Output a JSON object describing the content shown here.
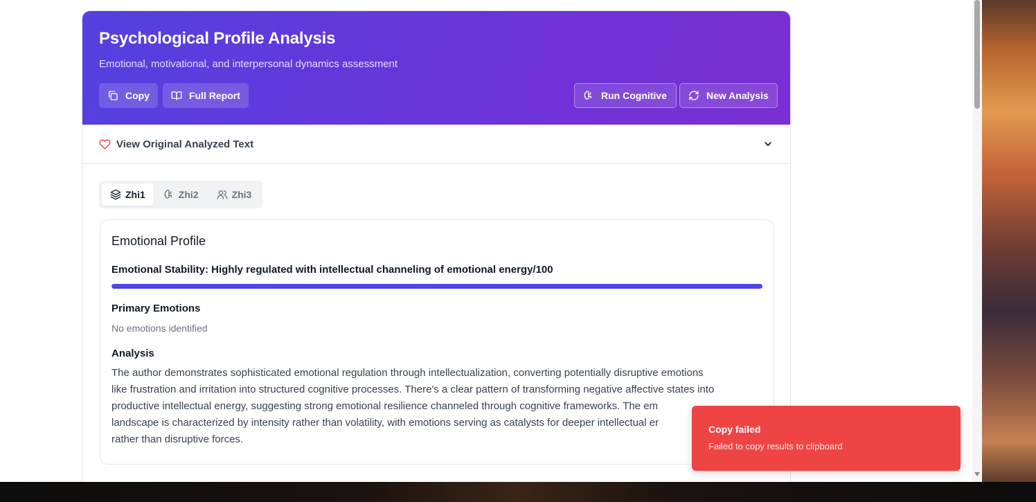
{
  "header": {
    "title": "Psychological Profile Analysis",
    "subtitle": "Emotional, motivational, and interpersonal dynamics assessment",
    "buttons": {
      "copy": "Copy",
      "full_report": "Full Report",
      "run_cognitive": "Run Cognitive",
      "new_analysis": "New Analysis"
    }
  },
  "original_text": {
    "label": "View Original Analyzed Text"
  },
  "tabs": [
    {
      "label": "Zhi1",
      "icon": "layers-icon",
      "active": true
    },
    {
      "label": "Zhi2",
      "icon": "brain-icon",
      "active": false
    },
    {
      "label": "Zhi3",
      "icon": "users-icon",
      "active": false
    }
  ],
  "profile": {
    "title": "Emotional Profile",
    "stability_label": "Emotional Stability: Highly regulated with intellectual channeling of emotional energy/100",
    "stability_fill": 1.0,
    "primary_emotions_title": "Primary Emotions",
    "primary_emotions_value": "No emotions identified",
    "analysis_title": "Analysis",
    "analysis_lines": [
      "The author demonstrates sophisticated emotional regulation through intellectualization, converting potentially disruptive emotions",
      "like frustration and irritation into structured cognitive processes. There's a clear pattern of transforming negative affective states into",
      "productive intellectual energy, suggesting strong emotional resilience channeled through cognitive frameworks. The em",
      "landscape is characterized by intensity rather than volatility, with emotions serving as catalysts for deeper intellectual er",
      "rather than disruptive forces."
    ]
  },
  "toast": {
    "title": "Copy failed",
    "message": "Failed to copy results to clipboard"
  },
  "colors": {
    "accent": "#4f46e5",
    "header_gradient_start": "#5341e0",
    "header_gradient_end": "#7a2fd2",
    "toast_bg": "#ef4444",
    "heart": "#ef4444"
  }
}
